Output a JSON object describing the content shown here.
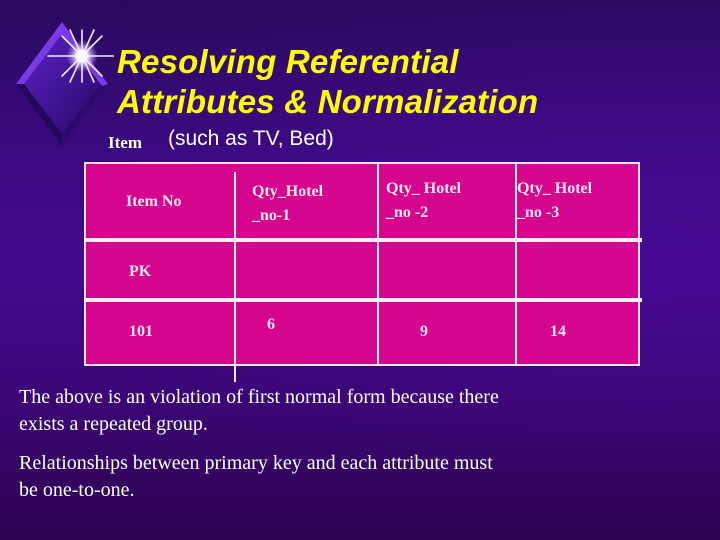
{
  "slide": {
    "title_line1": "Resolving Referential",
    "title_line2": "Attributes & Normalization",
    "subtitle_label": "Item",
    "subtitle_text": "(such as TV, Bed)",
    "colors": {
      "title": "#ffff00",
      "table_fill": "#d6058e",
      "table_lines": "#f8eef6",
      "background": "#3b0a82",
      "text": "#ffffff"
    },
    "logo_icon": "sparkle-diamond-icon"
  },
  "table": {
    "headers": [
      "Item No",
      "Qty_Hotel _no-1",
      "Qty_ Hotel _no -2",
      "Qty_ Hotel _no -3"
    ],
    "header_lines": [
      [
        "Item No"
      ],
      [
        "Qty_Hotel",
        "_no-1"
      ],
      [
        "Qty_ Hotel",
        "_no -2"
      ],
      [
        "Qty_ Hotel",
        "_no -3"
      ]
    ],
    "rows": [
      [
        "PK",
        "",
        "",
        ""
      ],
      [
        "101",
        "6",
        "9",
        "14"
      ]
    ]
  },
  "notes": [
    {
      "line1": "The above is an violation of first normal form because there",
      "line2": "exists a repeated group."
    },
    {
      "line1": "Relationships between primary key and each attribute must",
      "line2": "be one-to-one."
    }
  ]
}
